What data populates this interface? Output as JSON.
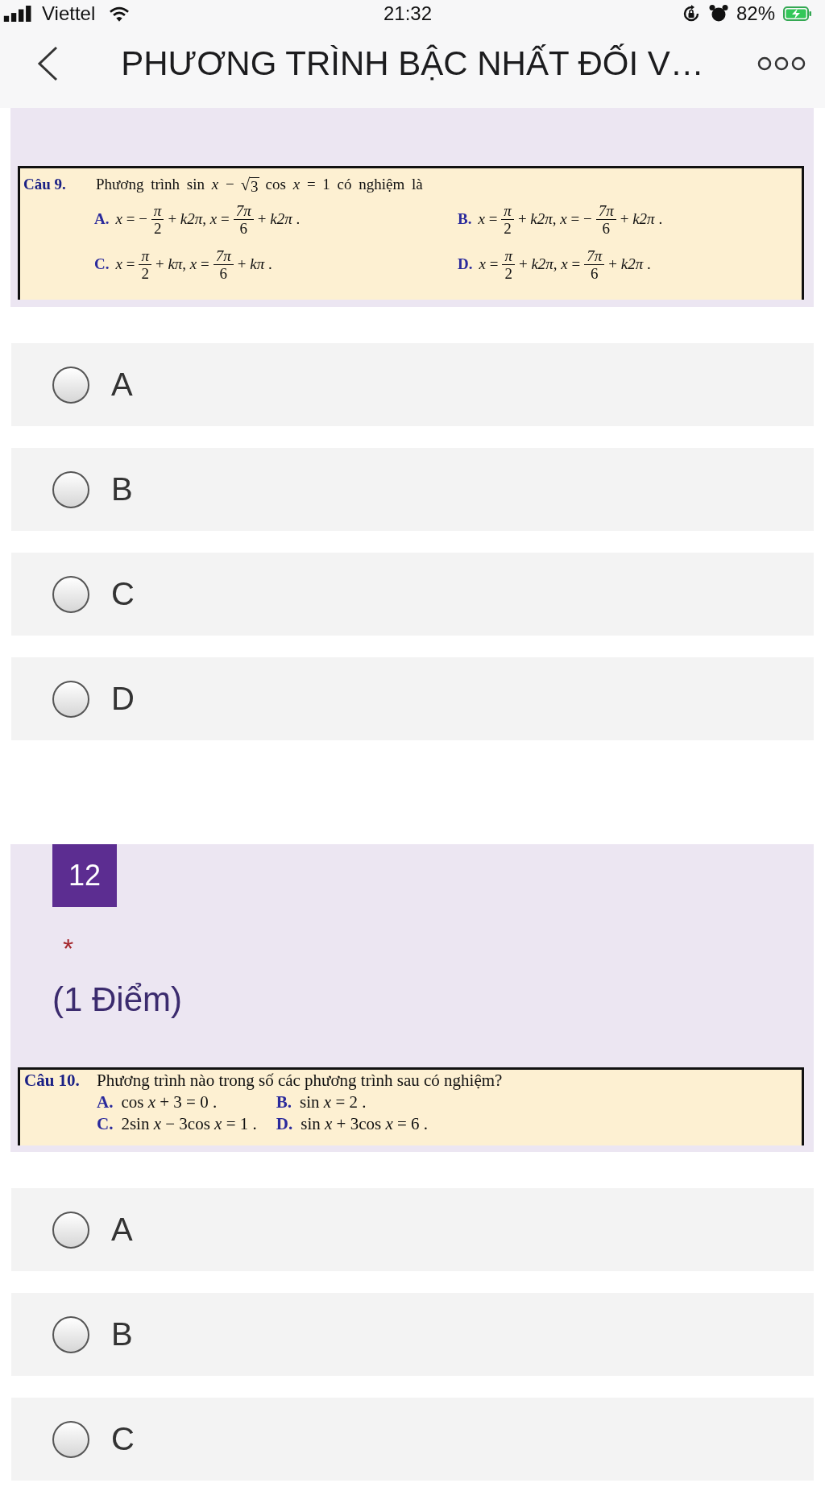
{
  "status_bar": {
    "carrier": "Viettel",
    "time": "21:32",
    "battery_percent": "82%"
  },
  "header": {
    "title": "PHƯƠNG TRÌNH BẬC NHẤT ĐỐI V…"
  },
  "questions": [
    {
      "document": {
        "label": "Câu 9.",
        "stem": [
          {
            "kind": "text",
            "s": "Phương trình sin *x* −"
          },
          {
            "kind": "sqrt",
            "sign": "√",
            "s": "3"
          },
          {
            "kind": "text",
            "s": "cos *x* = 1 có nghiệm là"
          }
        ],
        "options": [
          {
            "label": "A.",
            "parts": [
              {
                "kind": "text",
                "s": "*x* = −"
              },
              {
                "kind": "frac",
                "num": "*π*",
                "den": "2"
              },
              {
                "kind": "text",
                "s": "+ *k2π*, *x* ="
              },
              {
                "kind": "frac",
                "num": "*7π*",
                "den": "6"
              },
              {
                "kind": "text",
                "s": "+ *k2π* ."
              }
            ]
          },
          {
            "label": "B.",
            "parts": [
              {
                "kind": "text",
                "s": "*x* ="
              },
              {
                "kind": "frac",
                "num": "*π*",
                "den": "2"
              },
              {
                "kind": "text",
                "s": "+ *k2π*, *x* = −"
              },
              {
                "kind": "frac",
                "num": "*7π*",
                "den": "6"
              },
              {
                "kind": "text",
                "s": "+ *k2π* ."
              }
            ]
          },
          {
            "label": "C.",
            "parts": [
              {
                "kind": "text",
                "s": "*x* ="
              },
              {
                "kind": "frac",
                "num": "*π*",
                "den": "2"
              },
              {
                "kind": "text",
                "s": "+ *kπ*, *x* ="
              },
              {
                "kind": "frac",
                "num": "*7π*",
                "den": "6"
              },
              {
                "kind": "text",
                "s": "+ *kπ* ."
              }
            ]
          },
          {
            "label": "D.",
            "parts": [
              {
                "kind": "text",
                "s": "*x* ="
              },
              {
                "kind": "frac",
                "num": "*π*",
                "den": "2"
              },
              {
                "kind": "text",
                "s": "+ *k2π*, *x* ="
              },
              {
                "kind": "frac",
                "num": "*7π*",
                "den": "6"
              },
              {
                "kind": "text",
                "s": "+ *k2π* ."
              }
            ]
          }
        ]
      },
      "choices": [
        {
          "label": "A",
          "selected": false
        },
        {
          "label": "B",
          "selected": false
        },
        {
          "label": "C",
          "selected": false
        },
        {
          "label": "D",
          "selected": false
        }
      ]
    },
    {
      "number": "12",
      "required_mark": "*",
      "points": "(1 Điểm)",
      "document": {
        "label": "Câu 10.",
        "stem": [
          {
            "kind": "text",
            "s": "Phương trình nào trong số các phương trình sau có nghiệm?"
          }
        ],
        "options": [
          {
            "label": "A.",
            "parts": [
              {
                "kind": "text",
                "s": "cos *x* + 3 = 0 ."
              }
            ]
          },
          {
            "label": "B.",
            "parts": [
              {
                "kind": "text",
                "s": "sin *x* = 2 ."
              }
            ]
          },
          {
            "label": "C.",
            "parts": [
              {
                "kind": "text",
                "s": "2sin *x* − 3cos *x* = 1 ."
              }
            ]
          },
          {
            "label": "D.",
            "parts": [
              {
                "kind": "text",
                "s": "sin *x* + 3cos *x* = 6 ."
              }
            ]
          }
        ]
      },
      "choices": [
        {
          "label": "A",
          "selected": false
        },
        {
          "label": "B",
          "selected": false
        },
        {
          "label": "C",
          "selected": false
        }
      ]
    }
  ]
}
